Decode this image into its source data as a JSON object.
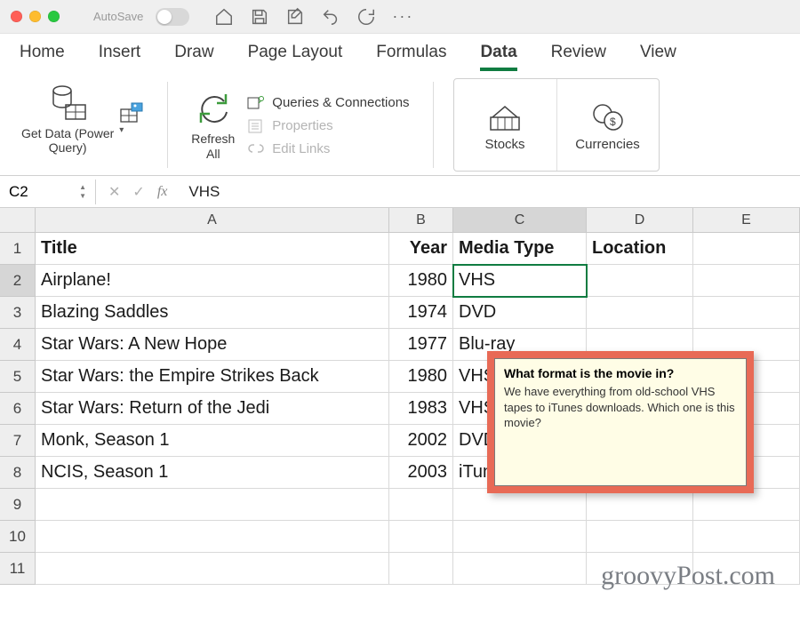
{
  "titlebar": {
    "autosave_label": "AutoSave"
  },
  "tabs": [
    "Home",
    "Insert",
    "Draw",
    "Page Layout",
    "Formulas",
    "Data",
    "Review",
    "View"
  ],
  "ribbon": {
    "get_data": "Get Data (Power\nQuery)",
    "refresh_all": "Refresh\nAll",
    "queries": "Queries & Connections",
    "properties": "Properties",
    "edit_links": "Edit Links",
    "stocks": "Stocks",
    "currencies": "Currencies"
  },
  "formula_bar": {
    "namebox": "C2",
    "fx": "fx",
    "value": "VHS"
  },
  "columns": [
    "A",
    "B",
    "C",
    "D",
    "E"
  ],
  "headers": {
    "title": "Title",
    "year": "Year",
    "media": "Media Type",
    "location": "Location"
  },
  "rows": [
    {
      "title": "Airplane!",
      "year": 1980,
      "media": "VHS"
    },
    {
      "title": "Blazing Saddles",
      "year": 1974,
      "media": "DVD"
    },
    {
      "title": "Star Wars: A New Hope",
      "year": 1977,
      "media": "Blu-ray"
    },
    {
      "title": "Star Wars: the Empire Strikes Back",
      "year": 1980,
      "media": "VHS"
    },
    {
      "title": "Star Wars: Return of the Jedi",
      "year": 1983,
      "media": "VHS"
    },
    {
      "title": "Monk, Season 1",
      "year": 2002,
      "media": "DVD"
    },
    {
      "title": "NCIS, Season 1",
      "year": 2003,
      "media": "iTunes"
    }
  ],
  "comment": {
    "title": "What format is the movie in?",
    "body": "We have everything from old-school VHS tapes to iTunes downloads. Which one is this movie?"
  },
  "watermark": "groovyPost.com"
}
